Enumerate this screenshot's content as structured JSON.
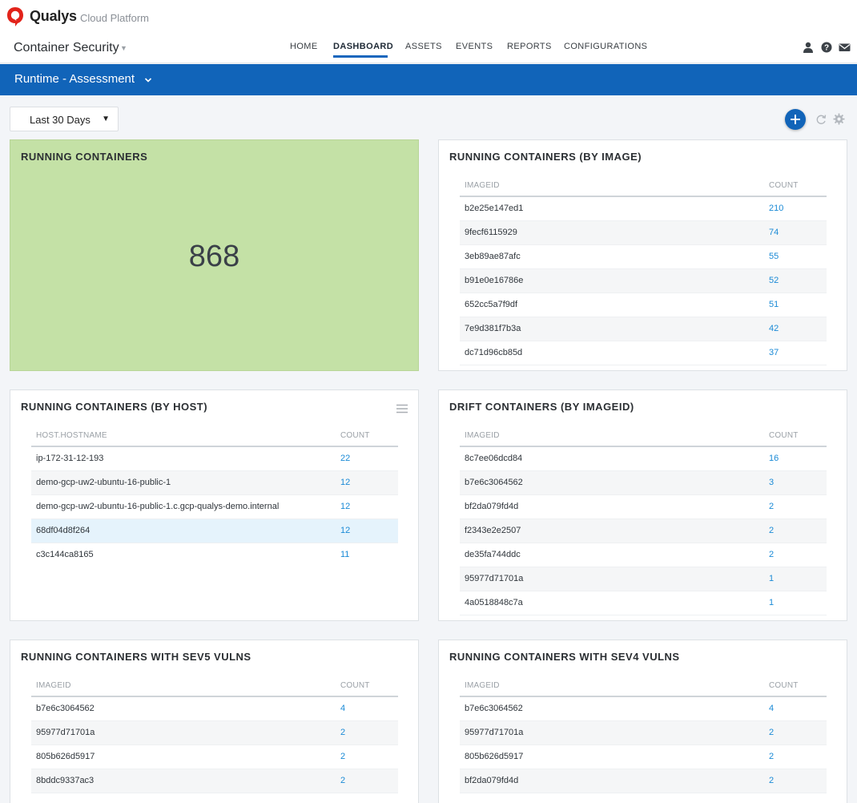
{
  "brand": {
    "name": "Qualys",
    "sub": "Cloud Platform"
  },
  "app": {
    "name": "Container Security"
  },
  "nav": {
    "tabs": [
      {
        "label": "HOME",
        "active": false
      },
      {
        "label": "DASHBOARD",
        "active": true
      },
      {
        "label": "ASSETS",
        "active": false
      },
      {
        "label": "EVENTS",
        "active": false
      },
      {
        "label": "REPORTS",
        "active": false
      },
      {
        "label": "CONFIGURATIONS",
        "active": false
      }
    ],
    "icons": [
      "user-icon",
      "help-icon",
      "mail-icon"
    ]
  },
  "section": {
    "title": "Runtime - Assessment"
  },
  "filter": {
    "date_range": "Last 30 Days"
  },
  "colors": {
    "accent": "#1164b9",
    "tile_green": "#c4e1a6",
    "link": "#1a8ad6"
  },
  "widgets": {
    "running": {
      "title": "RUNNING CONTAINERS",
      "value": "868"
    },
    "by_image": {
      "title": "RUNNING CONTAINERS (BY IMAGE)",
      "col1": "IMAGEID",
      "col2": "COUNT",
      "rows": [
        {
          "k": "b2e25e147ed1",
          "v": "210"
        },
        {
          "k": "9fecf6115929",
          "v": "74"
        },
        {
          "k": "3eb89ae87afc",
          "v": "55"
        },
        {
          "k": "b91e0e16786e",
          "v": "52"
        },
        {
          "k": "652cc5a7f9df",
          "v": "51"
        },
        {
          "k": "7e9d381f7b3a",
          "v": "42"
        },
        {
          "k": "dc71d96cb85d",
          "v": "37"
        }
      ]
    },
    "by_host": {
      "title": "RUNNING CONTAINERS (BY HOST)",
      "col1": "HOST.HOSTNAME",
      "col2": "COUNT",
      "rows": [
        {
          "k": "ip-172-31-12-193",
          "v": "22"
        },
        {
          "k": "demo-gcp-uw2-ubuntu-16-public-1",
          "v": "12"
        },
        {
          "k": "demo-gcp-uw2-ubuntu-16-public-1.c.gcp-qualys-demo.internal",
          "v": "12"
        },
        {
          "k": "68df04d8f264",
          "v": "12"
        },
        {
          "k": "c3c144ca8165",
          "v": "11"
        }
      ]
    },
    "drift": {
      "title": "DRIFT CONTAINERS (BY IMAGEID)",
      "col1": "IMAGEID",
      "col2": "COUNT",
      "rows": [
        {
          "k": "8c7ee06dcd84",
          "v": "16"
        },
        {
          "k": "b7e6c3064562",
          "v": "3"
        },
        {
          "k": "bf2da079fd4d",
          "v": "2"
        },
        {
          "k": "f2343e2e2507",
          "v": "2"
        },
        {
          "k": "de35fa744ddc",
          "v": "2"
        },
        {
          "k": "95977d71701a",
          "v": "1"
        },
        {
          "k": "4a0518848c7a",
          "v": "1"
        }
      ]
    },
    "sev5": {
      "title": "RUNNING CONTAINERS WITH SEV5 VULNS",
      "col1": "IMAGEID",
      "col2": "COUNT",
      "rows": [
        {
          "k": "b7e6c3064562",
          "v": "4"
        },
        {
          "k": "95977d71701a",
          "v": "2"
        },
        {
          "k": "805b626d5917",
          "v": "2"
        },
        {
          "k": "8bddc9337ac3",
          "v": "2"
        }
      ]
    },
    "sev4": {
      "title": "RUNNING CONTAINERS WITH SEV4 VULNS",
      "col1": "IMAGEID",
      "col2": "COUNT",
      "rows": [
        {
          "k": "b7e6c3064562",
          "v": "4"
        },
        {
          "k": "95977d71701a",
          "v": "2"
        },
        {
          "k": "805b626d5917",
          "v": "2"
        },
        {
          "k": "bf2da079fd4d",
          "v": "2"
        }
      ]
    }
  }
}
